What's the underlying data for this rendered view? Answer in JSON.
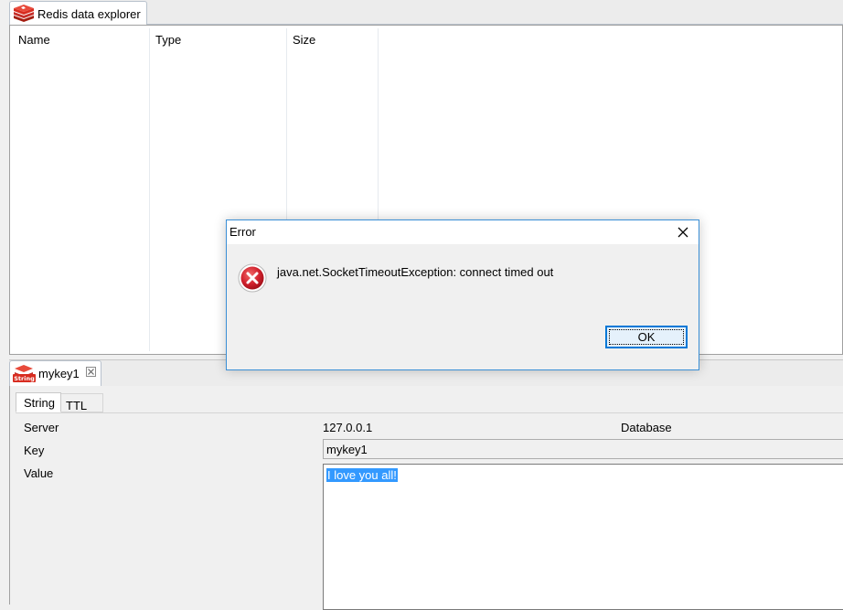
{
  "explorer": {
    "tab_label": "Redis data explorer",
    "icon": "redis-icon",
    "columns": [
      "Name",
      "Type",
      "Size"
    ]
  },
  "editor": {
    "tab_label": "mykey1",
    "tab_icon": "string-type-icon",
    "tab_icon_text": "String",
    "close_icon": "close-tab-icon",
    "subtabs": [
      "String",
      "TTL"
    ],
    "server_label": "Server",
    "server_value": "127.0.0.1",
    "database_label": "Database",
    "key_label": "Key",
    "key_value": "mykey1",
    "value_label": "Value",
    "value_text": "I love you all!"
  },
  "dialog": {
    "title": "Error",
    "message": "java.net.SocketTimeoutException: connect timed out",
    "ok_label": "OK",
    "icon": "error-icon",
    "close_icon": "close-icon"
  },
  "colors": {
    "accent": "#0078d7",
    "selection": "#3399ff",
    "error_red": "#c8102e",
    "redis_red": "#d82c20"
  }
}
